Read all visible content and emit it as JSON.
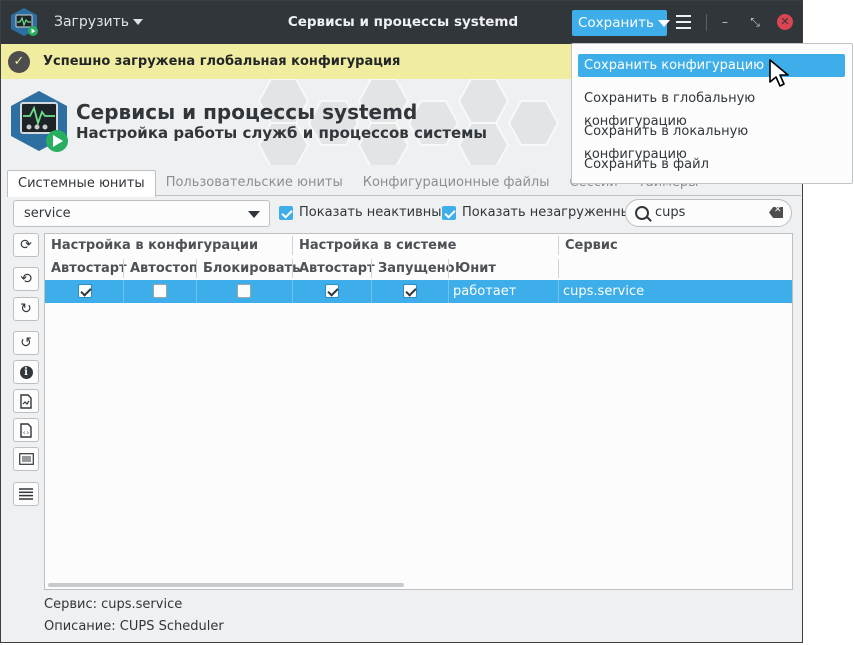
{
  "titlebar": {
    "load_label": "Загрузить",
    "title": "Сервисы и процессы systemd",
    "save_label": "Сохранить",
    "close_glyph": "✕",
    "minimize_glyph": "–",
    "restore_glyph": "⤡"
  },
  "banner": {
    "text": "Успешно загружена глобальная конфигурация",
    "icon": "check-circle-icon"
  },
  "header": {
    "title": "Сервисы и процессы systemd",
    "subtitle": "Настройка работы служб и процессов системы"
  },
  "tabs": [
    {
      "label": "Системные юниты",
      "active": true
    },
    {
      "label": "Пользовательские юниты",
      "active": false
    },
    {
      "label": "Конфигурационные файлы",
      "active": false
    },
    {
      "label": "Сессии",
      "active": false
    },
    {
      "label": "Таймеры",
      "active": false
    }
  ],
  "filter": {
    "type_value": "service",
    "show_inactive_label": "Показать неактивные",
    "show_inactive": true,
    "show_unloaded_label": "Показать незагруженные",
    "show_unloaded": true,
    "search_value": "cups"
  },
  "tools": [
    "refresh-icon",
    "history-icon",
    "redo-icon",
    "undo-icon",
    "info-icon",
    "file-icon",
    "code-file-icon",
    "list-icon",
    "lines-icon"
  ],
  "table": {
    "group_headers": {
      "config": "Настройка в конфигурации",
      "system": "Настройка в системе",
      "service": "Сервис"
    },
    "columns": {
      "autostart": "Автостарт",
      "autostop": "Автостоп",
      "block": "Блокировать",
      "sys_autostart": "Автостарт",
      "running": "Запущено",
      "unit": "Юнит"
    },
    "rows": [
      {
        "autostart": true,
        "autostop": false,
        "block": false,
        "sys_autostart": true,
        "running": true,
        "unit": "работает",
        "service": "cups.service"
      }
    ]
  },
  "info": {
    "service_label": "Сервис:",
    "service_value": "cups.service",
    "description_label": "Описание:",
    "description_value": "CUPS Scheduler"
  },
  "menu": {
    "items": [
      "Сохранить конфигурацию",
      "Сохранить в глобальную конфигурацию",
      "Сохранить в локальную конфигурацию",
      "Сохранить в файл"
    ],
    "highlighted_index": 0
  },
  "colors": {
    "accent": "#3daee9",
    "titlebar": "#31363b",
    "banner": "#f0eda0",
    "close": "#da4453"
  }
}
